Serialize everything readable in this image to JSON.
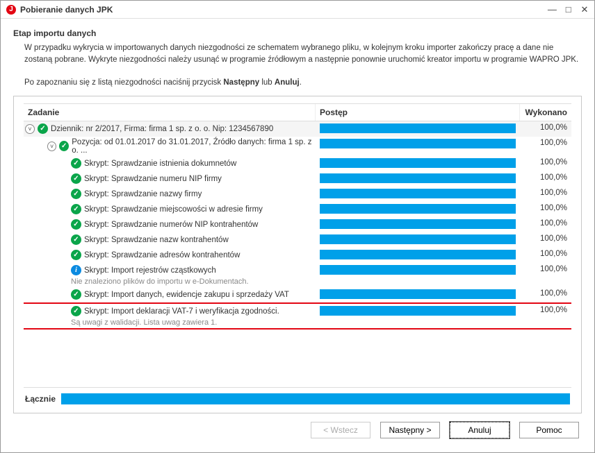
{
  "window": {
    "title": "Pobieranie danych JPK"
  },
  "stage": {
    "title": "Etap importu danych",
    "desc_part1": "W przypadku wykrycia w importowanych danych niezgodności ze schematem wybranego pliku, w kolejnym kroku importer zakończy pracę a dane nie zostaną pobrane. Wykryte niezgodności należy usunąć w programie źródłowym a następnie ponownie uruchomić kreator importu w programie WAPRO JPK.",
    "desc_part2a": "Po zapoznaniu się z listą niezgodności naciśnij przycisk ",
    "desc_em1": "Następny",
    "desc_part2b": " lub ",
    "desc_em2": "Anuluj",
    "desc_part2c": "."
  },
  "columns": {
    "task": "Zadanie",
    "progress": "Postęp",
    "done": "Wykonano"
  },
  "rows": [
    {
      "indent": 0,
      "expand": true,
      "status": "ok",
      "label": "Dziennik: nr 2/2017, Firma: firma 1 sp. z o. o. Nip: 1234567890",
      "done": "100,0%",
      "bg": true
    },
    {
      "indent": 1,
      "expand": true,
      "status": "ok",
      "label": "Pozycja: od 01.01.2017 do 31.01.2017, Źródło danych: firma 1 sp. z o. ...",
      "done": "100,0%"
    },
    {
      "indent": 2,
      "status": "ok",
      "label": "Skrypt: Sprawdzanie istnienia dokumnetów",
      "done": "100,0%"
    },
    {
      "indent": 2,
      "status": "ok",
      "label": "Skrypt: Sprawdzanie numeru NIP firmy",
      "done": "100,0%"
    },
    {
      "indent": 2,
      "status": "ok",
      "label": "Skrypt: Sprawdzanie nazwy firmy",
      "done": "100,0%"
    },
    {
      "indent": 2,
      "status": "ok",
      "label": "Skrypt: Sprawdzanie miejscowości w adresie firmy",
      "done": "100,0%"
    },
    {
      "indent": 2,
      "status": "ok",
      "label": "Skrypt: Sprawdzanie numerów NIP kontrahentów",
      "done": "100,0%"
    },
    {
      "indent": 2,
      "status": "ok",
      "label": "Skrypt: Sprawdzanie nazw kontrahentów",
      "done": "100,0%"
    },
    {
      "indent": 2,
      "status": "ok",
      "label": "Skrypt: Sprawdzanie adresów kontrahentów",
      "done": "100,0%"
    },
    {
      "indent": 2,
      "status": "info",
      "label": "Skrypt: Import rejestrów cząstkowych",
      "sub": "Nie znaleziono plików do importu w e-Dokumentach.",
      "done": "100,0%"
    },
    {
      "indent": 2,
      "status": "ok",
      "label": "Skrypt: Import danych, ewidencje zakupu i sprzedaży VAT",
      "done": "100,0%"
    },
    {
      "indent": 2,
      "status": "ok",
      "label": "Skrypt: Import deklaracji VAT-7 i weryfikacja zgodności.",
      "sub": "Są uwagi z walidacji. Lista uwag zawiera 1.",
      "done": "100,0%",
      "highlight": true
    }
  ],
  "footer": {
    "label": "Łącznie"
  },
  "buttons": {
    "back": "< Wstecz",
    "next": "Następny >",
    "cancel": "Anuluj",
    "help": "Pomoc"
  }
}
